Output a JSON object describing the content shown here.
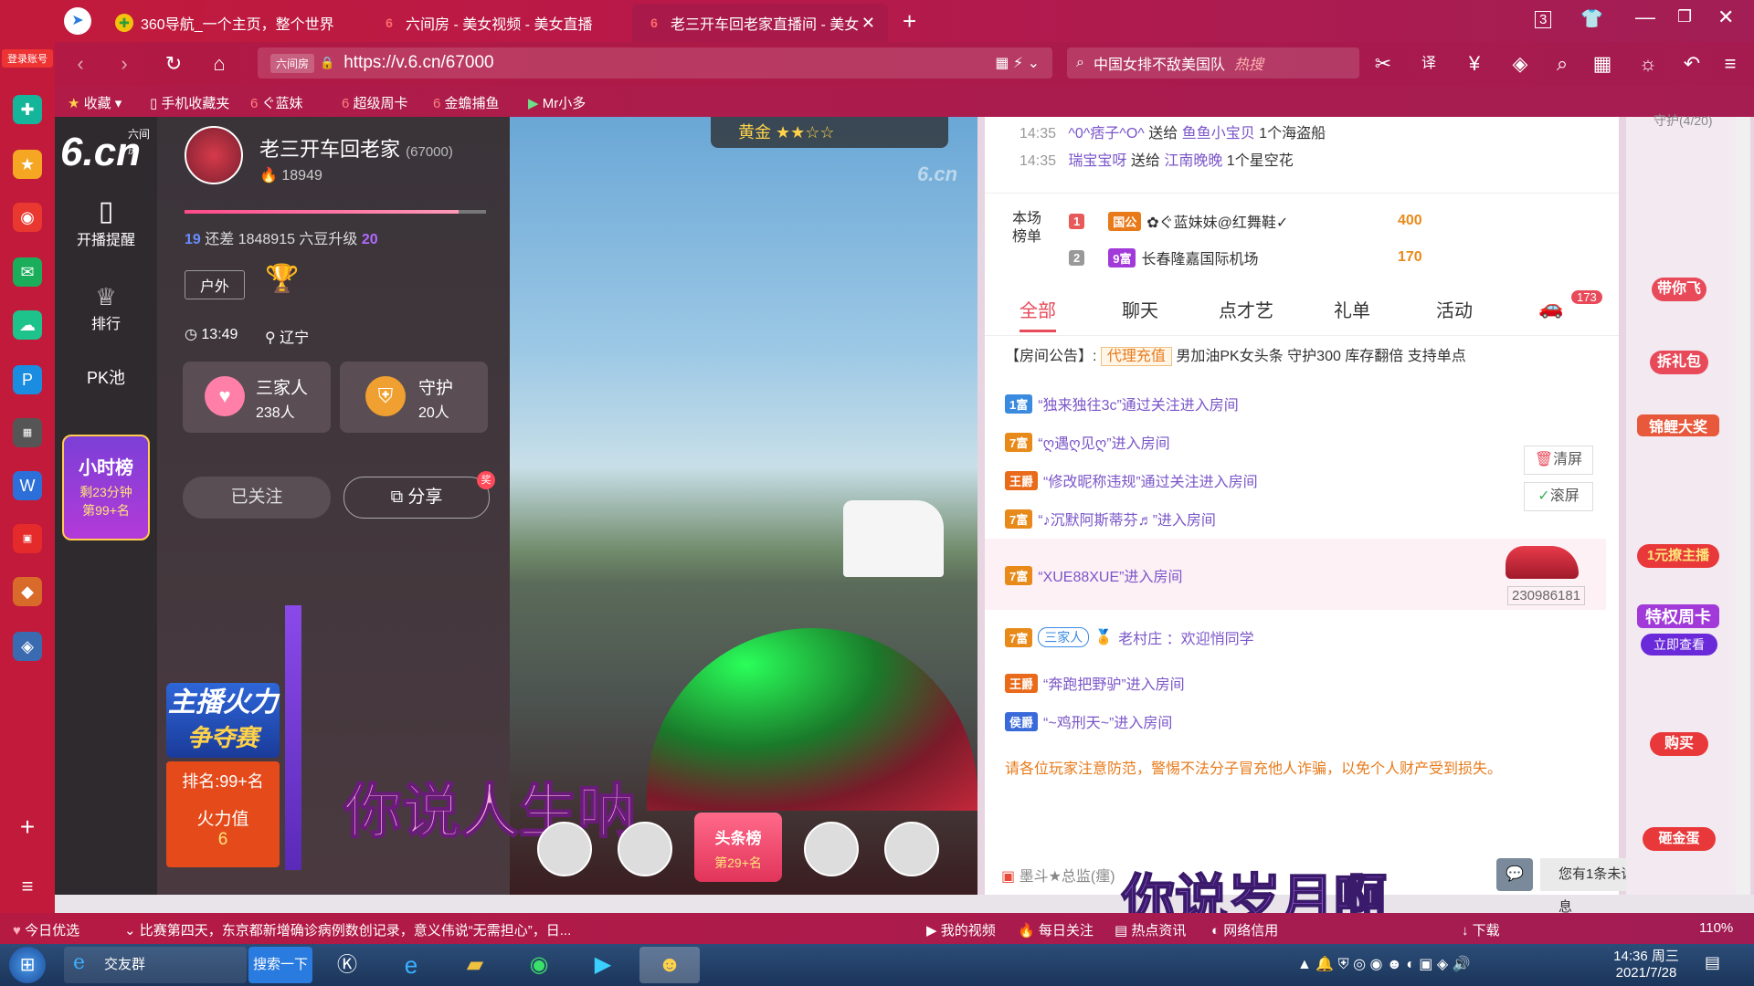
{
  "left_strip": {
    "login": "登录账号"
  },
  "tabs": [
    {
      "label": "360导航_一个主页，整个世界"
    },
    {
      "label": "六间房 - 美女视频 - 美女直播"
    },
    {
      "label": "老三开车回老家直播间 - 美女"
    }
  ],
  "nav": {
    "url_prefix": "六间房",
    "url": "https://v.6.cn/67000",
    "search": "中国女排不敌美国队",
    "search_badge": "热搜"
  },
  "bookmarks": [
    "收藏",
    "手机收藏夹",
    "ぐ蓝妹",
    "超级周卡",
    "金蟾捕鱼",
    "Mr小多"
  ],
  "site": {
    "logo_top": "六间房",
    "logo": "6.cn",
    "items": [
      {
        "label": "开播提醒"
      },
      {
        "label": "排行"
      },
      {
        "label": "PK池"
      }
    ],
    "hour_rank": "小时榜",
    "hour_left": "剩23分钟",
    "hour_pos": "第99+名"
  },
  "host": {
    "name": "老三开车回老家",
    "id": "(67000)",
    "fans": "18949",
    "level_from": "19",
    "level_to": "20",
    "need": "还差 1848915 六豆升级",
    "tag": "户外",
    "time": "13:49",
    "location": "辽宁",
    "family_label": "三家人",
    "family_count": "238人",
    "guard_label": "守护",
    "guard_count": "20人",
    "follow": "已关注",
    "share": "分享",
    "share_badge": "奖",
    "fire_title": "主播火力",
    "fire_sub": "争夺赛",
    "fire_rank": "排名:99+名",
    "fire_val_label": "火力值",
    "fire_val": "6"
  },
  "video": {
    "watermark": "6.cn",
    "badge": "黄金",
    "sub1": "你说人生呐",
    "sub2": "你说岁月啊",
    "headline_badge": "头条榜",
    "headline_pos": "第29+名"
  },
  "gifts": [
    {
      "time": "14:35",
      "user": "^0^痞子^O^",
      "verb": "送给",
      "to": "鱼鱼小宝贝",
      "item": "1个海盗船"
    },
    {
      "time": "14:35",
      "user": "瑞宝宝呀",
      "verb": "送给",
      "to": "江南晚晚",
      "item": "1个星空花"
    }
  ],
  "rank": {
    "label": "本场榜单",
    "rows": [
      {
        "n": "1",
        "tag": "国公",
        "name": "✿ぐ蓝妹妹@红舞鞋✓",
        "score": "400"
      },
      {
        "n": "2",
        "tag": "9富",
        "name": "长春隆嘉国际机场",
        "score": "170"
      }
    ]
  },
  "chat_tabs": [
    "全部",
    "聊天",
    "点才艺",
    "礼单",
    "活动"
  ],
  "car_count": "173",
  "notice": {
    "label": "【房间公告】:",
    "tag": "代理充值",
    "text": "男加油PK女头条 守护300 库存翻倍 支持单点"
  },
  "messages": [
    {
      "badge": "1富",
      "text": "“独来独往3c”通过关注进入房间"
    },
    {
      "badge": "7富",
      "text": "“ღ遇ღ见ღ”进入房间"
    },
    {
      "badge": "王爵",
      "text": "“修改昵称违规”通过关注进入房间"
    },
    {
      "badge": "7富",
      "text": "“♪沉默阿斯蒂芬♬”进入房间"
    },
    {
      "badge": "7富",
      "text": "“XUE88XUE”进入房间"
    },
    {
      "badge": "7富",
      "text": "老村庄 ：欢迎悄同学"
    },
    {
      "badge": "王爵",
      "text": "“奔跑把野驴”进入房间"
    },
    {
      "badge": "侯爵",
      "text": "“~鸡刑天~”进入房间"
    }
  ],
  "family_tag": "三家人",
  "car_id": "230986181",
  "tools": {
    "clear": "清屏",
    "scroll": "滚屏"
  },
  "warning": "请各位玩家注意防范，警惕不法分子冒充他人诈骗，以免个人财产受到损失。",
  "bottom": {
    "user": "墨斗★总监(癦)",
    "unread": "您有1条未读消息"
  },
  "right": {
    "guard": "守护(4/20)",
    "items": [
      "带你飞",
      "拆礼包",
      "锦鲤大奖",
      "1元撩主播",
      "特权周卡",
      "立即查看",
      "购买",
      "砸金蛋"
    ]
  },
  "status": {
    "news_label": "今日优选",
    "news": "比赛第四天，东京都新增确诊病例数创记录，意义伟说“无需担心”，日...",
    "links": [
      "我的视频",
      "每日关注",
      "热点资讯",
      "网络信用",
      "下载"
    ],
    "zoom": "110%"
  },
  "taskbar": {
    "app": "交友群",
    "search": "搜索一下",
    "time": "14:36 周三",
    "date": "2021/7/28"
  }
}
